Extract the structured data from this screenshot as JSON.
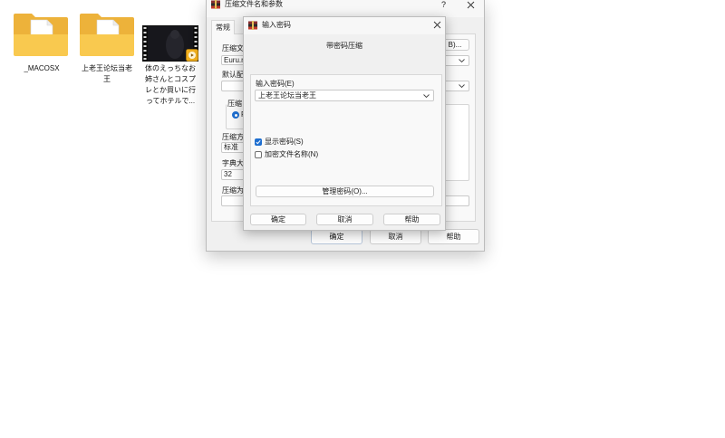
{
  "desktop": {
    "icons": [
      {
        "icon": "folder-icon",
        "label_lines": [
          "_MACOSX"
        ]
      },
      {
        "icon": "folder-icon",
        "label_lines": [
          "上老王论坛当老",
          "王"
        ]
      },
      {
        "icon": "video-thumbnail",
        "badge_icon": "media-player-icon",
        "label_lines": [
          "体のえっちなお",
          "姉さんとコスプ",
          "レとか買いに行",
          "ってホテルで..."
        ]
      }
    ]
  },
  "archive_dialog": {
    "app_icon": "winrar-icon",
    "title": "压缩文件名和参数",
    "help_glyph": "?",
    "close_icon": "close-icon",
    "tabs": [
      {
        "label": "常规",
        "selected": true
      }
    ],
    "archive_name": {
      "label": "压缩文",
      "value": "Euru.m"
    },
    "profile": {
      "label": "默认配"
    },
    "format_group": {
      "label": "压缩",
      "option_label": "R",
      "option_checked": true
    },
    "method": {
      "label": "压缩方",
      "value": "标准"
    },
    "dictionary": {
      "label": "字典大",
      "value": "32"
    },
    "split": {
      "label": "压缩为"
    },
    "browse_button": "B)...",
    "buttons": {
      "ok": "确定",
      "cancel": "取消",
      "help": "帮助"
    }
  },
  "password_dialog": {
    "app_icon": "winrar-icon",
    "title": "输入密码",
    "close_icon": "close-icon",
    "heading": "带密码压缩",
    "password": {
      "label": "输入密码(E)",
      "value": "上老王论坛当老王"
    },
    "show_password": {
      "label": "显示密码(S)",
      "checked": true
    },
    "encrypt_file_names": {
      "label": "加密文件名称(N)",
      "checked": false
    },
    "manage_button": "管理密码(O)...",
    "buttons": {
      "ok": "确定",
      "cancel": "取消",
      "help": "帮助"
    }
  },
  "colors": {
    "accent": "#1f6fd0",
    "folder_back": "#edb23a",
    "folder_front": "#f9c94f",
    "dialog_bg": "#f0f0f0"
  }
}
